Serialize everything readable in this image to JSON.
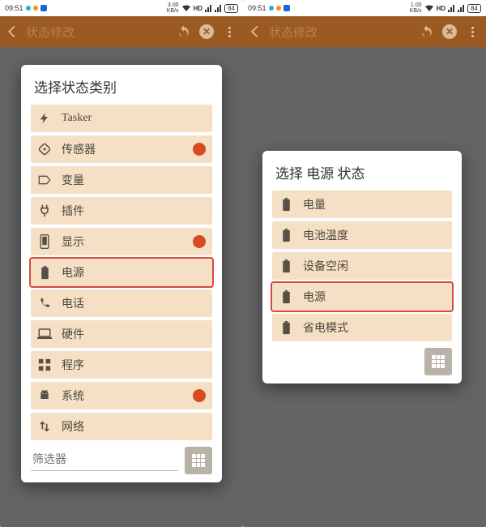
{
  "statusbar": {
    "time": "09:51",
    "rate_left": "3.00",
    "rate_right": "1.00",
    "rate_unit": "KB/s",
    "hd": "HD",
    "batt": "84"
  },
  "titlebar": {
    "title": "状态修改"
  },
  "left_card": {
    "title": "选择状态类别",
    "items": [
      {
        "icon": "bolt-icon",
        "label": "Tasker",
        "dot": false
      },
      {
        "icon": "rotate-icon",
        "label": "传感器",
        "dot": true
      },
      {
        "icon": "tag-icon",
        "label": "变量",
        "dot": false
      },
      {
        "icon": "plug-icon",
        "label": "插件",
        "dot": false
      },
      {
        "icon": "phone-icon",
        "label": "显示",
        "dot": true
      },
      {
        "icon": "battery-icon",
        "label": "电源",
        "dot": false,
        "highlight": true
      },
      {
        "icon": "call-icon",
        "label": "电话",
        "dot": false
      },
      {
        "icon": "laptop-icon",
        "label": "硬件",
        "dot": false
      },
      {
        "icon": "apps-icon",
        "label": "程序",
        "dot": false
      },
      {
        "icon": "android-icon",
        "label": "系统",
        "dot": true
      },
      {
        "icon": "updown-icon",
        "label": "网络",
        "dot": false
      }
    ],
    "filter_placeholder": "筛选器"
  },
  "right_card": {
    "title": "选择 电源 状态",
    "items": [
      {
        "icon": "battery-icon",
        "label": "电量"
      },
      {
        "icon": "battery-icon",
        "label": "电池温度"
      },
      {
        "icon": "battery-icon",
        "label": "设备空闲"
      },
      {
        "icon": "battery-icon",
        "label": "电源",
        "highlight": true
      },
      {
        "icon": "battery-icon",
        "label": "省电模式"
      }
    ]
  }
}
